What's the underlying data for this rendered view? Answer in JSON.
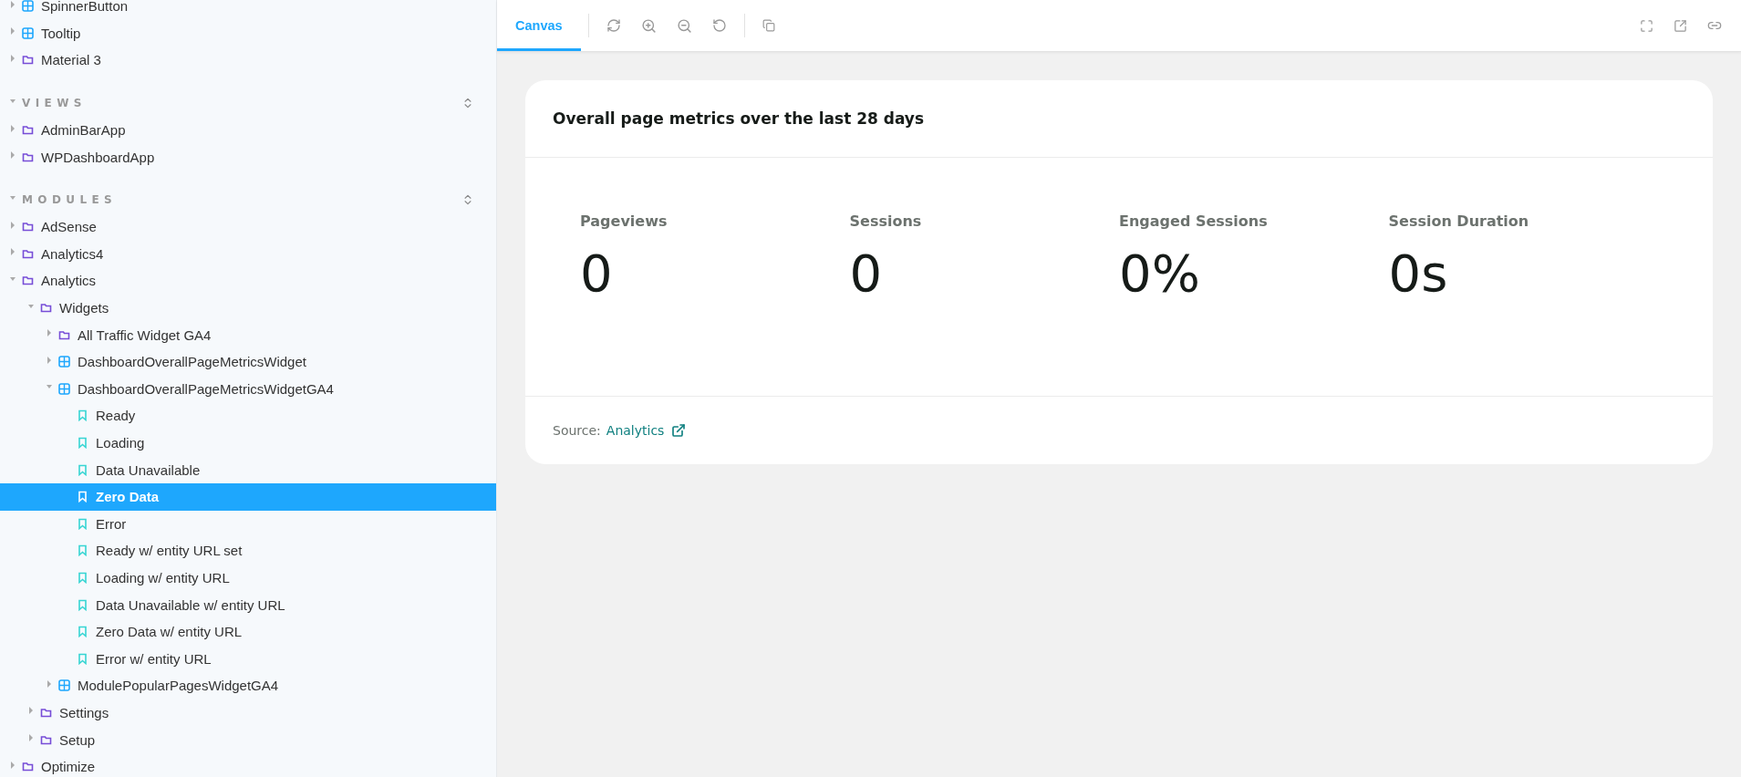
{
  "sidebar": {
    "sections": [
      {
        "items": [
          {
            "label": "SpinnerButton",
            "kind": "component",
            "expanded": false
          },
          {
            "label": "Tooltip",
            "kind": "component",
            "expanded": false
          },
          {
            "label": "Material 3",
            "kind": "folder",
            "expanded": false
          }
        ]
      },
      {
        "title": "VIEWS",
        "expanded": true,
        "items": [
          {
            "label": "AdminBarApp",
            "kind": "folder",
            "expanded": false
          },
          {
            "label": "WPDashboardApp",
            "kind": "folder",
            "expanded": false
          }
        ]
      },
      {
        "title": "MODULES",
        "expanded": true,
        "items": [
          {
            "label": "AdSense",
            "kind": "folder",
            "expanded": false
          },
          {
            "label": "Analytics4",
            "kind": "folder",
            "expanded": false
          },
          {
            "label": "Analytics",
            "kind": "folder",
            "expanded": true,
            "children": [
              {
                "label": "Widgets",
                "kind": "folder",
                "expanded": true,
                "children": [
                  {
                    "label": "All Traffic Widget GA4",
                    "kind": "folder",
                    "expanded": false
                  },
                  {
                    "label": "DashboardOverallPageMetricsWidget",
                    "kind": "component",
                    "expanded": false
                  },
                  {
                    "label": "DashboardOverallPageMetricsWidgetGA4",
                    "kind": "component",
                    "expanded": true,
                    "children": [
                      {
                        "label": "Ready",
                        "kind": "story",
                        "selected": false
                      },
                      {
                        "label": "Loading",
                        "kind": "story",
                        "selected": false
                      },
                      {
                        "label": "Data Unavailable",
                        "kind": "story",
                        "selected": false
                      },
                      {
                        "label": "Zero Data",
                        "kind": "story",
                        "selected": true
                      },
                      {
                        "label": "Error",
                        "kind": "story",
                        "selected": false
                      },
                      {
                        "label": "Ready w/ entity URL set",
                        "kind": "story",
                        "selected": false
                      },
                      {
                        "label": "Loading w/ entity URL",
                        "kind": "story",
                        "selected": false
                      },
                      {
                        "label": "Data Unavailable w/ entity URL",
                        "kind": "story",
                        "selected": false
                      },
                      {
                        "label": "Zero Data w/ entity URL",
                        "kind": "story",
                        "selected": false
                      },
                      {
                        "label": "Error w/ entity URL",
                        "kind": "story",
                        "selected": false
                      }
                    ]
                  },
                  {
                    "label": "ModulePopularPagesWidgetGA4",
                    "kind": "component",
                    "expanded": false
                  }
                ]
              },
              {
                "label": "Settings",
                "kind": "folder",
                "expanded": false
              },
              {
                "label": "Setup",
                "kind": "folder",
                "expanded": false
              }
            ]
          },
          {
            "label": "Optimize",
            "kind": "folder",
            "expanded": false
          }
        ]
      }
    ]
  },
  "toolbar": {
    "tabs": [
      {
        "label": "Canvas",
        "selected": true
      }
    ]
  },
  "card": {
    "title": "Overall page metrics over the last 28 days",
    "metrics": [
      {
        "label": "Pageviews",
        "value": "0"
      },
      {
        "label": "Sessions",
        "value": "0"
      },
      {
        "label": "Engaged Sessions",
        "value": "0%"
      },
      {
        "label": "Session Duration",
        "value": "0s"
      }
    ],
    "source_label": "Source:",
    "source_link": "Analytics"
  }
}
